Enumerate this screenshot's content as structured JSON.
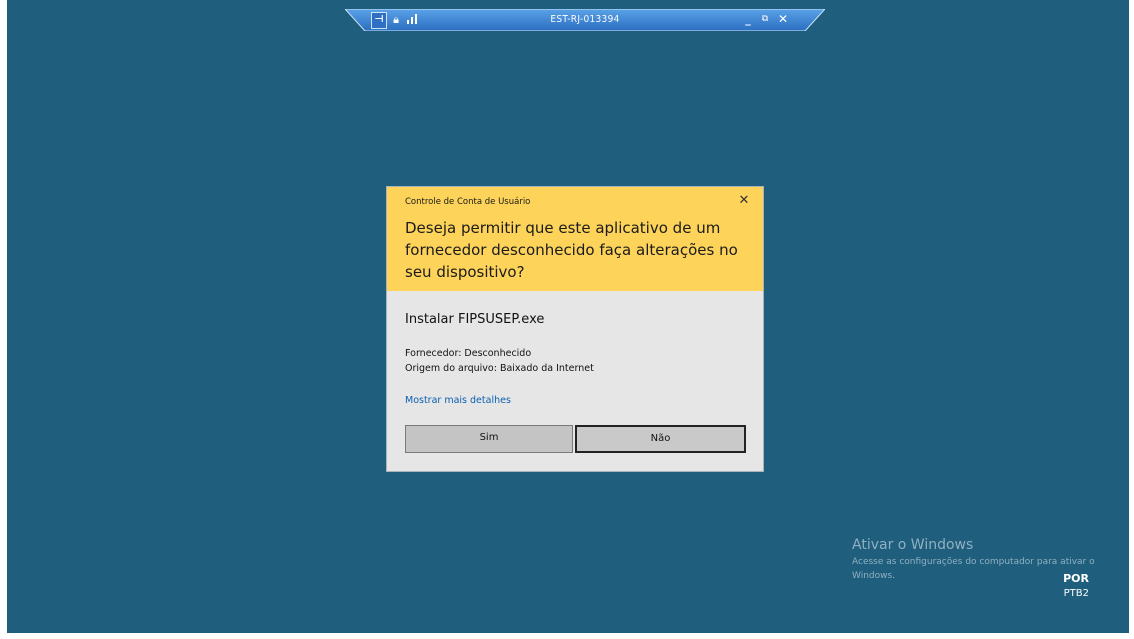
{
  "rdp_bar": {
    "title": "EST-RJ-013394",
    "pin_icon": "pin-icon",
    "lock_icon": "lock-icon",
    "signal_icon": "signal-icon",
    "minimize_symbol": "_",
    "restore_symbol": "⧉",
    "close_symbol": "✕",
    "accent": "#3a86d6"
  },
  "uac": {
    "caption": "Controle de Conta de Usuário",
    "close_symbol": "✕",
    "question": "Deseja permitir que este aplicativo de um fornecedor desconhecido faça alterações no seu dispositivo?",
    "app_name": "Instalar FIPSUSEP.exe",
    "publisher": "Fornecedor: Desconhecido",
    "origin": "Origem do arquivo: Baixado da Internet",
    "details_link": "Mostrar mais detalhes",
    "yes_label": "Sim",
    "no_label": "Não",
    "header_color": "#fdd35a"
  },
  "watermark": {
    "title": "Ativar o Windows",
    "subtitle": "Acesse as configurações do computador para ativar o Windows."
  },
  "language": {
    "code": "POR",
    "layout": "PTB2"
  },
  "desktop_color": "#1f5e7c"
}
